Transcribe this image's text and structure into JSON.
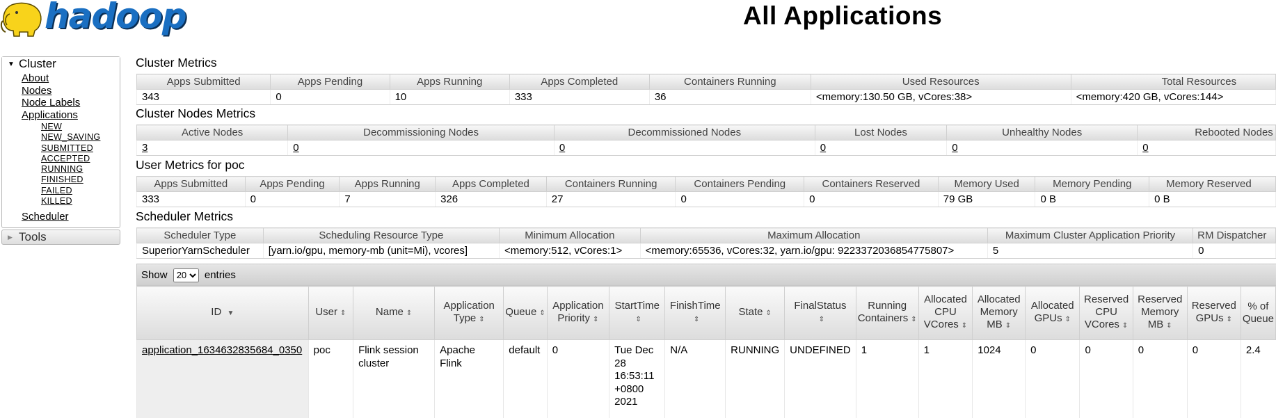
{
  "header": {
    "logo_text": "hadoop",
    "title": "All Applications"
  },
  "sidebar": {
    "cluster_label": "Cluster",
    "links": [
      "About",
      "Nodes",
      "Node Labels",
      "Applications"
    ],
    "app_states": [
      "NEW",
      "NEW_SAVING",
      "SUBMITTED",
      "ACCEPTED",
      "RUNNING",
      "FINISHED",
      "FAILED",
      "KILLED"
    ],
    "scheduler_label": "Scheduler",
    "tools_label": "Tools"
  },
  "cluster_metrics": {
    "title": "Cluster Metrics",
    "headers": [
      "Apps Submitted",
      "Apps Pending",
      "Apps Running",
      "Apps Completed",
      "Containers Running",
      "Used Resources",
      "Total Resources"
    ],
    "values": [
      "343",
      "0",
      "10",
      "333",
      "36",
      "<memory:130.50 GB, vCores:38>",
      "<memory:420 GB, vCores:144>"
    ]
  },
  "nodes_metrics": {
    "title": "Cluster Nodes Metrics",
    "headers": [
      "Active Nodes",
      "Decommissioning Nodes",
      "Decommissioned Nodes",
      "Lost Nodes",
      "Unhealthy Nodes",
      "Rebooted Nodes"
    ],
    "values": [
      "3",
      "0",
      "0",
      "0",
      "0",
      "0"
    ]
  },
  "user_metrics": {
    "title": "User Metrics for poc",
    "headers": [
      "Apps Submitted",
      "Apps Pending",
      "Apps Running",
      "Apps Completed",
      "Containers Running",
      "Containers Pending",
      "Containers Reserved",
      "Memory Used",
      "Memory Pending",
      "Memory Reserved"
    ],
    "values": [
      "333",
      "0",
      "7",
      "326",
      "27",
      "0",
      "0",
      "79 GB",
      "0 B",
      "0 B"
    ]
  },
  "scheduler_metrics": {
    "title": "Scheduler Metrics",
    "headers": [
      "Scheduler Type",
      "Scheduling Resource Type",
      "Minimum Allocation",
      "Maximum Allocation",
      "Maximum Cluster Application Priority",
      "RM Dispatcher"
    ],
    "values": [
      "SuperiorYarnScheduler",
      "[yarn.io/gpu, memory-mb (unit=Mi), vcores]",
      "<memory:512, vCores:1>",
      "<memory:65536, vCores:32, yarn.io/gpu: 9223372036854775807>",
      "5",
      "0"
    ]
  },
  "apps_table": {
    "show_label": "Show",
    "page_size": "20",
    "entries_label": "entries",
    "headers": [
      "ID",
      "User",
      "Name",
      "Application Type",
      "Queue",
      "Application Priority",
      "StartTime",
      "FinishTime",
      "State",
      "FinalStatus",
      "Running Containers",
      "Allocated CPU VCores",
      "Allocated Memory MB",
      "Allocated GPUs",
      "Reserved CPU VCores",
      "Reserved Memory MB",
      "Reserved GPUs",
      "% of Queue"
    ],
    "rows": [
      [
        "application_1634632835684_0350",
        "poc",
        "Flink session cluster",
        "Apache Flink",
        "default",
        "0",
        "Tue Dec 28 16:53:11 +0800 2021",
        "N/A",
        "RUNNING",
        "UNDEFINED",
        "1",
        "1",
        "1024",
        "0",
        "0",
        "0",
        "0",
        "2.4"
      ]
    ]
  }
}
